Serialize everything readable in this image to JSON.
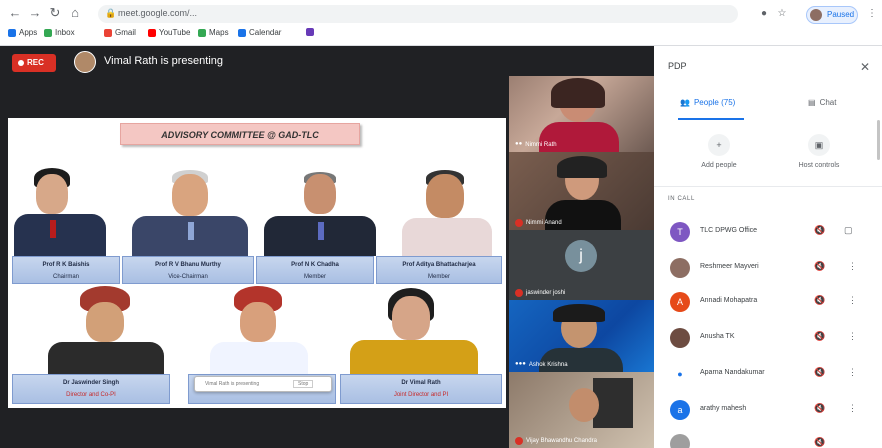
{
  "browser": {
    "url": "meet.google.com/...",
    "paused_label": "Paused",
    "bookmarks": [
      {
        "label": "Apps",
        "color": "#1a73e8"
      },
      {
        "label": "Inbox",
        "color": "#34a853"
      },
      {
        "label": "Gmail",
        "color": "#ea4335"
      },
      {
        "label": "YouTube",
        "color": "#ff0000"
      },
      {
        "label": "Maps",
        "color": "#34a853"
      },
      {
        "label": "Calendar",
        "color": "#1a73e8"
      },
      {
        "label": "",
        "color": "#673ab7"
      }
    ]
  },
  "meeting": {
    "rec_label": "REC",
    "presenting_text": "Vimal Rath is presenting"
  },
  "slide": {
    "title": "ADVISORY COMMITTEE @ GAD-TLC",
    "members_top": [
      {
        "name": "Prof R K Baishis",
        "role": "Chairman",
        "red": false
      },
      {
        "name": "Prof R V Bhanu Murthy",
        "role": "Vice-Chairman",
        "red": false
      },
      {
        "name": "Prof N K Chadha",
        "role": "Member",
        "red": false
      },
      {
        "name": "Prof Aditya Bhattacharjea",
        "role": "Member",
        "red": false
      }
    ],
    "members_bottom": [
      {
        "name": "Dr Jaswinder Singh",
        "role": "Director and Co-PI",
        "red": true
      },
      {
        "name": "",
        "role": "Member",
        "red": false
      },
      {
        "name": "Dr Vimal Rath",
        "role": "Joint Director and PI",
        "red": true
      }
    ],
    "overlay_text": "Vimal Rath is presenting",
    "overlay_btn": "Stop"
  },
  "tiles": [
    {
      "name": "Nimmi Rath",
      "mic": "dim"
    },
    {
      "name": "Nimmi Anand",
      "mic": "red"
    },
    {
      "name": "jaswinder joshi",
      "mic": "red",
      "initial": "j"
    },
    {
      "name": "Ashok Krishna",
      "mic": "dim"
    },
    {
      "name": "Vijay Bhawandhu Chandra",
      "mic": "red"
    }
  ],
  "panel": {
    "title": "PDP",
    "tab_people": "People (75)",
    "tab_chat": "Chat",
    "add_people": "Add people",
    "host_controls": "Host controls",
    "in_call": "IN CALL",
    "people": [
      {
        "name": "TLC DPWG Office",
        "initial": "T",
        "color": "#7e57c2"
      },
      {
        "name": "Reshmeer Mayveri",
        "initial": "",
        "color": "#8d6e63"
      },
      {
        "name": "Annadi Mohapatra",
        "initial": "A",
        "color": "#e64a19"
      },
      {
        "name": "Anusha TK",
        "initial": "",
        "color": "#6d4c41"
      },
      {
        "name": "Aparna Nandakumar",
        "initial": "",
        "color": "#ffffff"
      },
      {
        "name": "arathy mahesh",
        "initial": "a",
        "color": "#1a73e8"
      },
      {
        "name": "",
        "initial": "",
        "color": "#9e9e9e"
      }
    ]
  }
}
